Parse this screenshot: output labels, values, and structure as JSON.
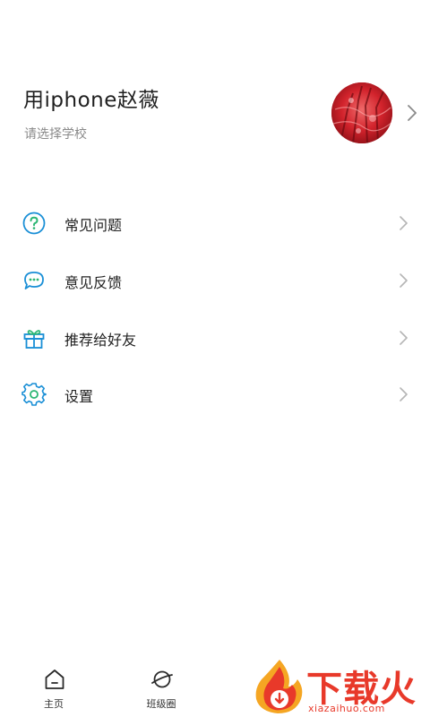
{
  "profile": {
    "name": "用iphone赵薇",
    "school": "请选择学校"
  },
  "menu": {
    "items": [
      {
        "label": "常见问题",
        "icon": "help-circle-icon"
      },
      {
        "label": "意见反馈",
        "icon": "chat-bubbles-icon"
      },
      {
        "label": "推荐给好友",
        "icon": "gift-icon"
      },
      {
        "label": "设置",
        "icon": "gear-icon"
      }
    ]
  },
  "bottom_nav": {
    "tabs": [
      {
        "label": "主页",
        "icon": "home-icon"
      },
      {
        "label": "班级圈",
        "icon": "planet-icon"
      }
    ]
  },
  "watermark": {
    "title": "下载火",
    "url": "xiazaihuo.com"
  },
  "colors": {
    "accent": "#1a8fd6",
    "accent_green": "#2bb673",
    "text_primary": "#222222",
    "text_secondary": "#8a8a8a",
    "chevron": "#b5b5b5",
    "watermark": "#e8392a"
  }
}
